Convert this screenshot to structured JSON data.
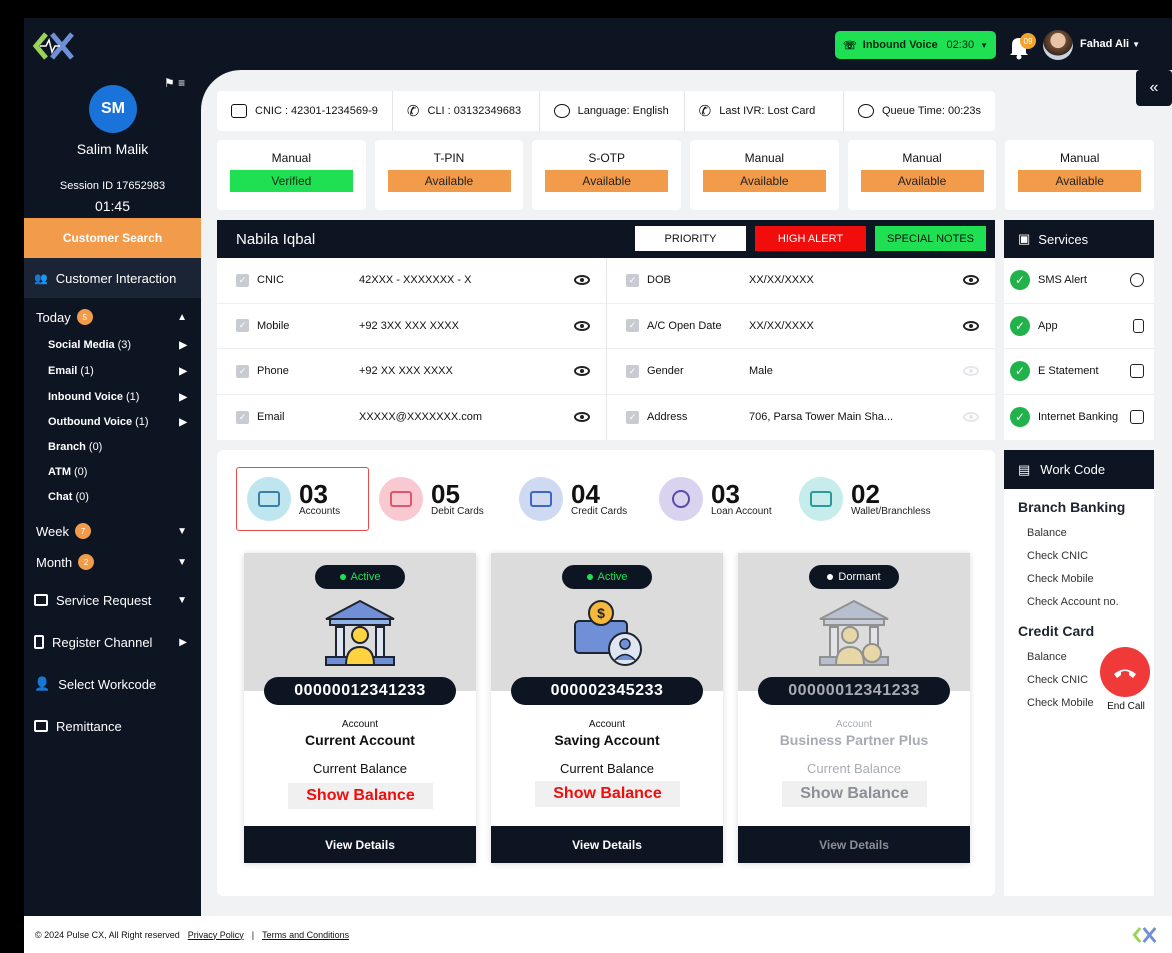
{
  "topbar": {
    "call_type": "Inbound Voice",
    "call_timer": "02:30",
    "notif_count": "09",
    "user_name": "Fahad Ali"
  },
  "agent": {
    "initials": "SM",
    "name": "Salim Malik",
    "session_id": "Session ID 17652983",
    "session_time": "01:45"
  },
  "sidebar": {
    "customer_search": "Customer Search",
    "customer_interaction": "Customer Interaction",
    "today": {
      "label": "Today",
      "count": "5"
    },
    "today_items": [
      {
        "label": "Social Media",
        "count": "(3)"
      },
      {
        "label": "Email",
        "count": "(1)"
      },
      {
        "label": "Inbound Voice",
        "count": "(1)"
      },
      {
        "label": "Outbound Voice",
        "count": "(1)"
      },
      {
        "label": "Branch",
        "count": "(0)"
      },
      {
        "label": "ATM",
        "count": "(0)"
      },
      {
        "label": "Chat",
        "count": "(0)"
      }
    ],
    "week": {
      "label": "Week",
      "count": "7"
    },
    "month": {
      "label": "Month",
      "count": "2"
    },
    "service_request": "Service Request",
    "register_channel": "Register Channel",
    "select_workcode": "Select Workcode",
    "remittance": "Remittance"
  },
  "infobar": {
    "cnic": "CNIC : 42301-1234569-9",
    "cli": "CLI : 03132349683",
    "language": "Language: English",
    "last_ivr": "Last IVR: Lost Card",
    "queue_time": "Queue Time: 00:23s"
  },
  "verifications": [
    {
      "label": "Manual",
      "status": "Verified",
      "color": "#1ee052"
    },
    {
      "label": "T-PIN",
      "status": "Available",
      "color": "#f29b4b"
    },
    {
      "label": "S-OTP",
      "status": "Available",
      "color": "#f29b4b"
    },
    {
      "label": "Manual",
      "status": "Available",
      "color": "#f29b4b"
    },
    {
      "label": "Manual",
      "status": "Available",
      "color": "#f29b4b"
    },
    {
      "label": "Manual",
      "status": "Available",
      "color": "#f29b4b"
    }
  ],
  "customer": {
    "name": "Nabila Iqbal",
    "tags": {
      "priority": "PRIORITY",
      "high_alert": "HIGH ALERT",
      "special_notes": "SPECIAL NOTES"
    },
    "left_fields": [
      {
        "label": "CNIC",
        "value": "42XXX - XXXXXXX - X"
      },
      {
        "label": "Mobile",
        "value": "+92 3XX XXX XXXX"
      },
      {
        "label": "Phone",
        "value": "+92 XX XXX XXXX"
      },
      {
        "label": "Email",
        "value": "XXXXX@XXXXXXX.com"
      }
    ],
    "right_fields": [
      {
        "label": "DOB",
        "value": "XX/XX/XXXX"
      },
      {
        "label": "A/C Open Date",
        "value": "XX/XX/XXXX"
      },
      {
        "label": "Gender",
        "value": "Male"
      },
      {
        "label": "Address",
        "value": "706, Parsa Tower Main Sha..."
      }
    ]
  },
  "services": {
    "title": "Services",
    "items": [
      "SMS Alert",
      "App",
      "E Statement",
      "Internet Banking"
    ]
  },
  "summary": [
    {
      "num": "03",
      "caption": "Accounts",
      "icon": "bank-icon"
    },
    {
      "num": "05",
      "caption": "Debit Cards",
      "icon": "debit-card-icon"
    },
    {
      "num": "04",
      "caption": "Credit Cards",
      "icon": "credit-card-icon"
    },
    {
      "num": "03",
      "caption": "Loan Account",
      "icon": "loan-icon"
    },
    {
      "num": "02",
      "caption": "Wallet/Branchless",
      "icon": "wallet-icon"
    }
  ],
  "accounts": [
    {
      "status": "Active",
      "number": "00000012341233",
      "label": "Account",
      "type": "Current Account",
      "balance_label": "Current Balance",
      "show_balance": "Show Balance",
      "view": "View Details"
    },
    {
      "status": "Active",
      "number": "000002345233",
      "label": "Account",
      "type": "Saving Account",
      "balance_label": "Current Balance",
      "show_balance": "Show Balance",
      "view": "View Details"
    },
    {
      "status": "Dormant",
      "number": "00000012341233",
      "label": "Account",
      "type": "Business Partner Plus",
      "balance_label": "Current Balance",
      "show_balance": "Show Balance",
      "view": "View Details"
    }
  ],
  "workcode": {
    "title": "Work Code",
    "branch_title": "Branch Banking",
    "branch_items": [
      "Balance",
      "Check CNIC",
      "Check Mobile",
      "Check Account no."
    ],
    "credit_title": "Credit Card",
    "credit_items": [
      "Balance",
      "Check CNIC",
      "Check Mobile"
    ]
  },
  "end_call": "End Call",
  "footer": {
    "copyright": "© 2024 Pulse CX, All Right reserved",
    "privacy": "Privacy Policy",
    "terms": "Terms and Conditions"
  },
  "colors": {
    "navy": "#0d1523",
    "green": "#1ee052",
    "orange": "#f29b4b",
    "red": "#f20d0d"
  }
}
